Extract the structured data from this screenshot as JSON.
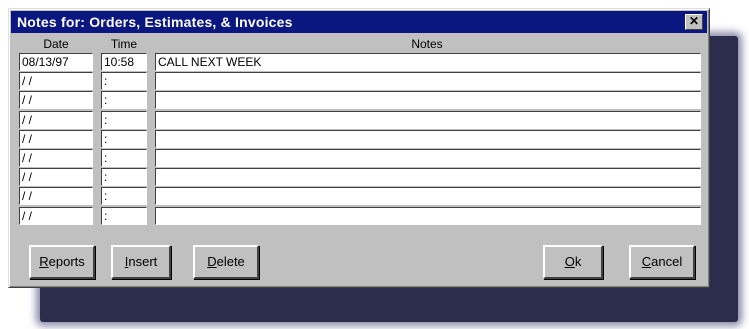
{
  "window": {
    "title": "Notes for: Orders, Estimates, & Invoices",
    "close_label": "✕"
  },
  "columns": {
    "date": "Date",
    "time": "Time",
    "notes": "Notes"
  },
  "rows": [
    {
      "date": "08/13/97",
      "time": "10:58",
      "note": "CALL NEXT WEEK"
    },
    {
      "date": " / /",
      "time": " :",
      "note": ""
    },
    {
      "date": " / /",
      "time": " :",
      "note": ""
    },
    {
      "date": " / /",
      "time": " :",
      "note": ""
    },
    {
      "date": " / /",
      "time": " :",
      "note": ""
    },
    {
      "date": " / /",
      "time": " :",
      "note": ""
    },
    {
      "date": " / /",
      "time": " :",
      "note": ""
    },
    {
      "date": " / /",
      "time": " :",
      "note": ""
    },
    {
      "date": " / /",
      "time": " :",
      "note": ""
    }
  ],
  "buttons": {
    "reports": {
      "mnemonic": "R",
      "rest": "eports"
    },
    "insert": {
      "mnemonic": "I",
      "rest": "nsert"
    },
    "delete": {
      "mnemonic": "D",
      "rest": "elete"
    },
    "ok": {
      "mnemonic": "O",
      "rest": "k"
    },
    "cancel": {
      "mnemonic": "C",
      "rest": "ancel"
    }
  }
}
